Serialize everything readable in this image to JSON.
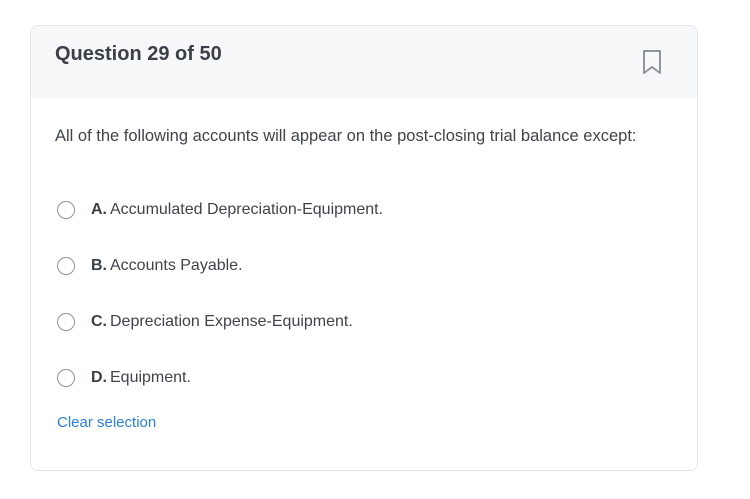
{
  "question": {
    "title": "Question 29 of 50",
    "text": "All of the following accounts will appear on the post-closing trial balance except:",
    "bookmark_icon": "bookmark-icon",
    "options": [
      {
        "letter": "A.",
        "text": "Accumulated Depreciation-Equipment."
      },
      {
        "letter": "B.",
        "text": "Accounts Payable."
      },
      {
        "letter": "C.",
        "text": "Depreciation Expense-Equipment."
      },
      {
        "letter": "D.",
        "text": "Equipment."
      }
    ],
    "clear_label": "Clear selection"
  },
  "colors": {
    "link": "#2b7fd6",
    "header_bg": "#f7f8fa",
    "text": "#3f444b"
  }
}
